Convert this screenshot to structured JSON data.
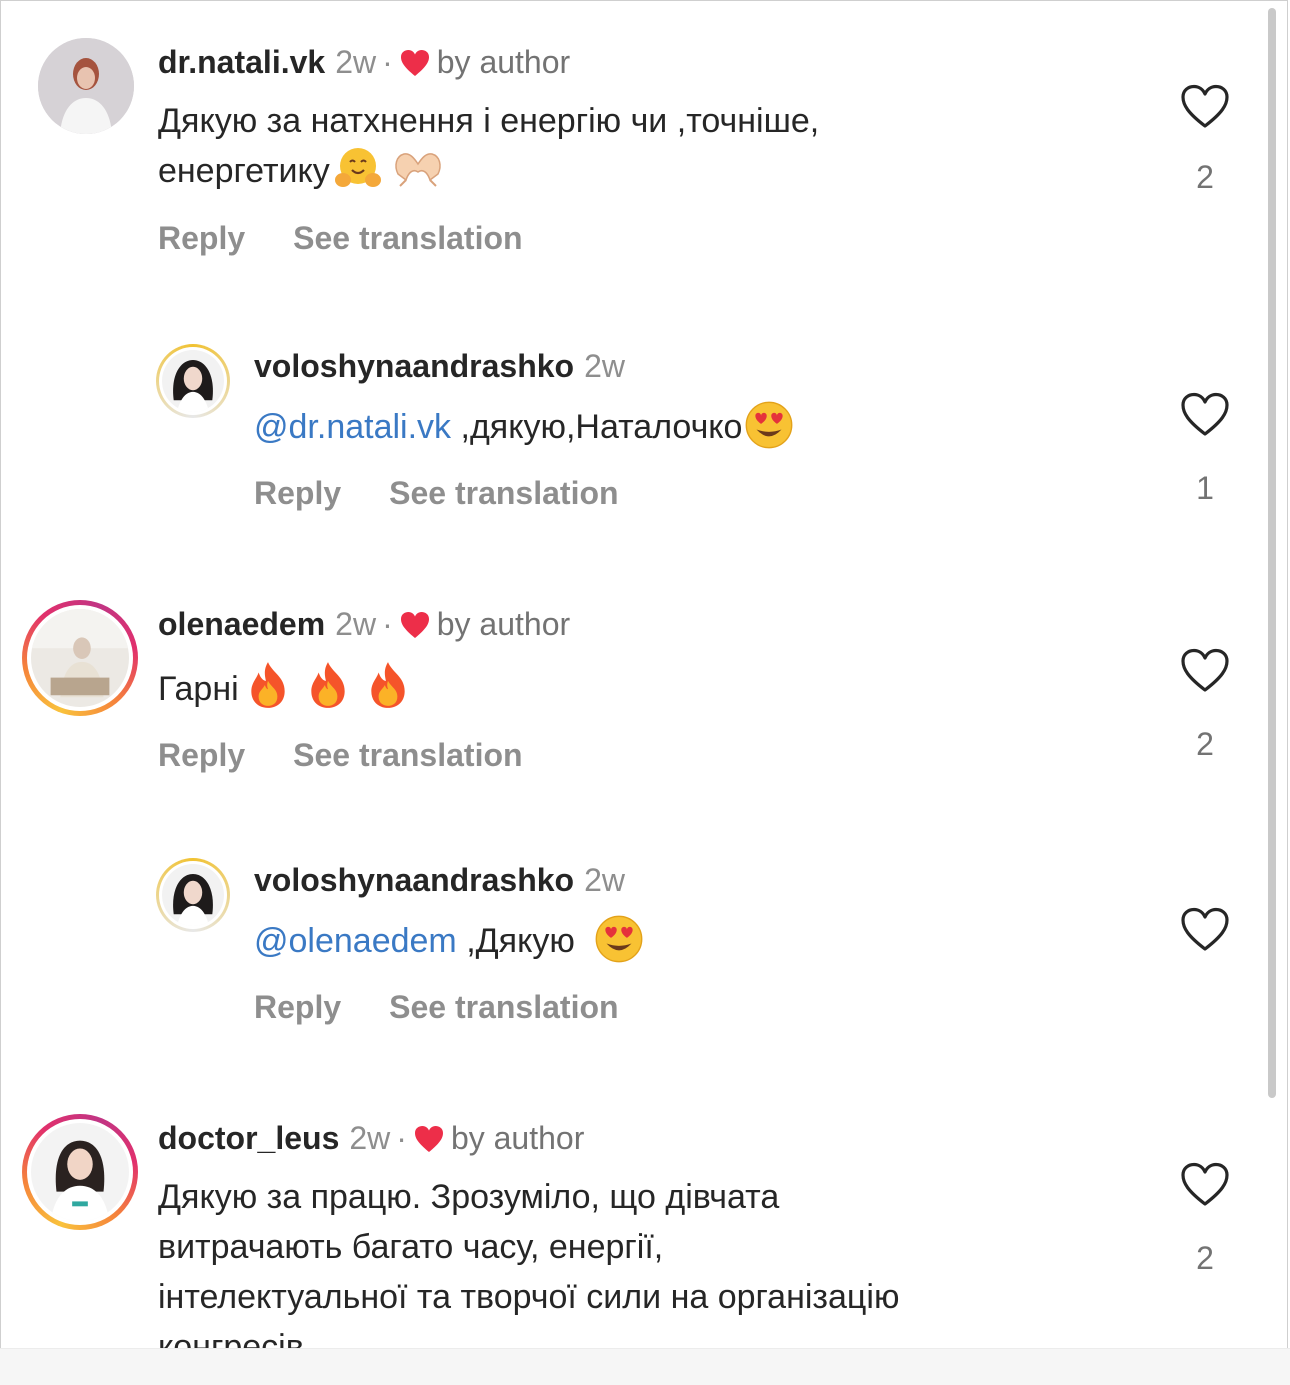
{
  "labels": {
    "reply": "Reply",
    "see_translation": "See translation",
    "by_author": "by author",
    "dot": "·"
  },
  "colors": {
    "heart_red": "#ed2e49",
    "mention_blue": "#3a79c4",
    "muted": "#8e8e8e"
  },
  "comments": [
    {
      "username": "dr.natali.vk",
      "time": "2w",
      "liked_by_author": true,
      "text_line1": "Дякую за натхнення і енергію чи ,точніше,",
      "text_line2": "енергетику",
      "emojis": [
        "hugging-face-emoji",
        "heart-hands-emoji"
      ],
      "like_count": "2",
      "avatar": "avatar-woman-white-coat"
    },
    {
      "username": "voloshynaandrashko",
      "time": "2w",
      "liked_by_author": false,
      "mention": "@dr.natali.vk",
      "text": " ,дякую,Наталочко",
      "emojis": [
        "heart-eyes-emoji"
      ],
      "like_count": "1",
      "avatar": "avatar-woman-dark-hair"
    },
    {
      "username": "olenaedem",
      "time": "2w",
      "liked_by_author": true,
      "text": "Гарні",
      "emojis": [
        "fire-emoji",
        "fire-emoji",
        "fire-emoji"
      ],
      "like_count": "2",
      "avatar": "avatar-seated-person"
    },
    {
      "username": "voloshynaandrashko",
      "time": "2w",
      "liked_by_author": false,
      "mention": "@olenaedem",
      "text": " ,Дякую ",
      "emojis": [
        "heart-eyes-emoji"
      ],
      "like_count": "",
      "avatar": "avatar-woman-dark-hair"
    },
    {
      "username": "doctor_leus",
      "time": "2w",
      "liked_by_author": true,
      "text_line1": "Дякую за працю. Зрозуміло, що дівчата",
      "text_line2": "витрачають багато часу, енергії,",
      "text_line3": "інтелектуальної та творчої сили на організацію",
      "text_line4": "конгресів.",
      "like_count": "2",
      "avatar": "avatar-woman-smiling"
    }
  ]
}
